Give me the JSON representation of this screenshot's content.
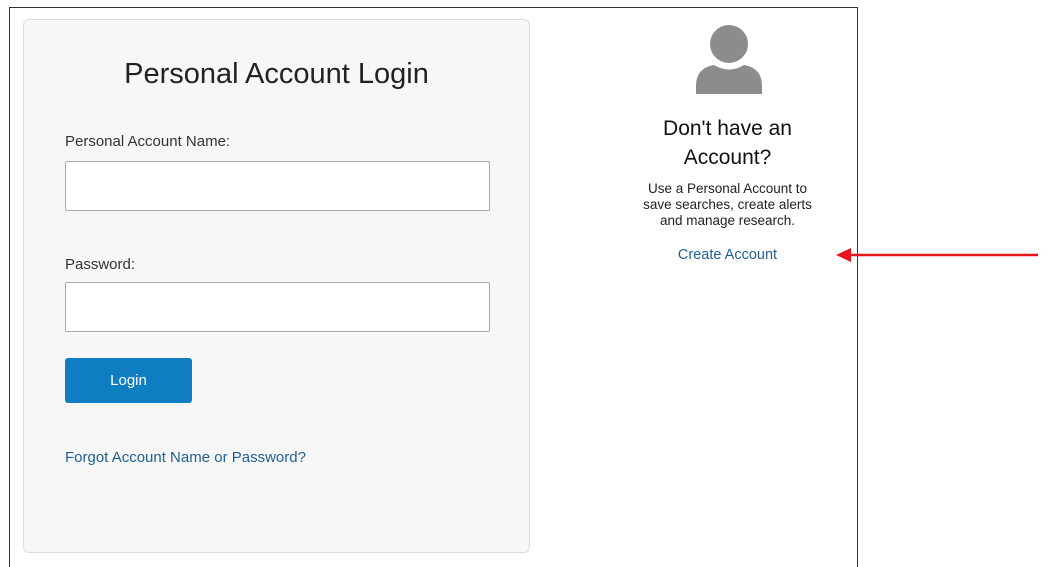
{
  "login": {
    "title": "Personal Account Login",
    "account_name_label": "Personal Account Name:",
    "account_name_value": "",
    "password_label": "Password:",
    "password_value": "",
    "login_button_label": "Login",
    "forgot_link_label": "Forgot Account Name or Password?"
  },
  "signup": {
    "heading_line1": "Don't have an",
    "heading_line2": "Account?",
    "description_line1": "Use a Personal Account to",
    "description_line2": "save searches, create alerts",
    "description_line3": "and manage research.",
    "create_link_label": "Create Account",
    "avatar_icon": "user-silhouette-icon"
  },
  "annotation": {
    "arrow_color": "#e8141b"
  },
  "colors": {
    "accent": "#0f7dc2",
    "link": "#1f5f95",
    "panel_bg": "#f7f7f7",
    "avatar": "#8c8c8c"
  }
}
